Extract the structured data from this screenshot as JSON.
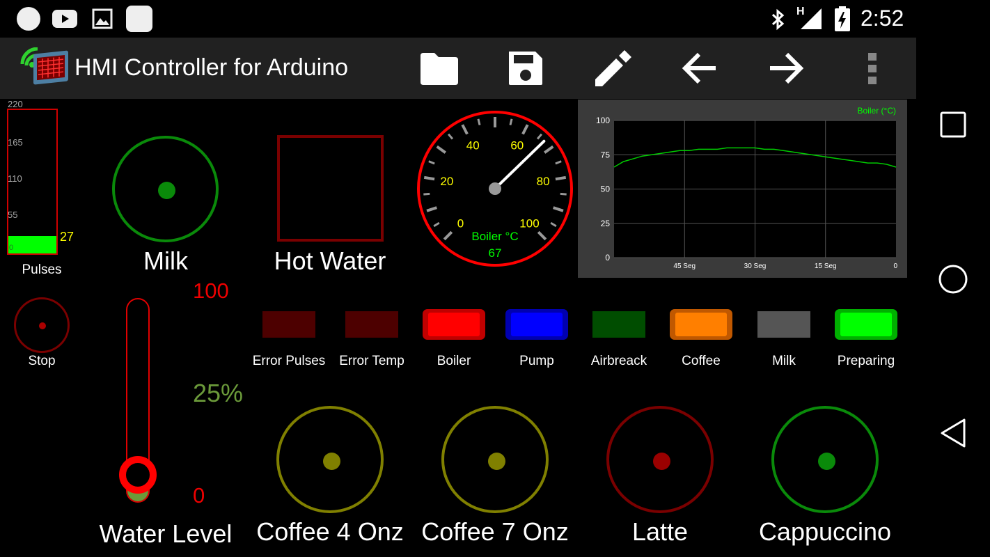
{
  "status_bar": {
    "time": "2:52",
    "network_type": "H"
  },
  "app_bar": {
    "title": "HMI Controller for Arduino",
    "actions": [
      "folder-icon",
      "save-icon",
      "edit-icon",
      "back-arrow-icon",
      "forward-arrow-icon",
      "more-vert-icon"
    ]
  },
  "pulses_bar": {
    "label": "Pulses",
    "ticks": [
      "220",
      "165",
      "110",
      "55",
      "0"
    ],
    "value": "27",
    "max": 220
  },
  "stop_button": {
    "label": "Stop"
  },
  "milk_button": {
    "label": "Milk"
  },
  "hot_water_button": {
    "label": "Hot Water"
  },
  "boiler_gauge": {
    "labels": [
      "0",
      "20",
      "40",
      "60",
      "80",
      "100"
    ],
    "unit_label": "Boiler °C",
    "value": "67"
  },
  "chart_data": {
    "type": "line",
    "legend": "Boiler (°C)",
    "legend_position": "top-right",
    "yticks": [
      "100",
      "75",
      "50",
      "25",
      "0"
    ],
    "xticks": [
      "45 Seg",
      "30 Seg",
      "15 Seg",
      "0"
    ],
    "ylim": [
      0,
      100
    ],
    "xlim": [
      60,
      0
    ],
    "grid": true,
    "series": [
      {
        "name": "Boiler (°C)",
        "x": [
          60,
          58,
          56,
          54,
          52,
          50,
          48,
          46,
          44,
          42,
          40,
          38,
          36,
          34,
          32,
          30,
          28,
          26,
          24,
          22,
          20,
          18,
          16,
          14,
          12,
          10,
          8,
          6,
          4,
          2,
          0
        ],
        "values": [
          66,
          70,
          72,
          74,
          75,
          76,
          77,
          78,
          78,
          79,
          79,
          79,
          80,
          80,
          80,
          80,
          79,
          79,
          78,
          77,
          76,
          75,
          74,
          73,
          72,
          71,
          70,
          69,
          69,
          68,
          66
        ]
      }
    ]
  },
  "water_level": {
    "label": "Water Level",
    "max": "100",
    "min": "0",
    "percent": "25%",
    "level": 0.25
  },
  "indicators": [
    {
      "label": "Error Pulses"
    },
    {
      "label": "Error Temp"
    },
    {
      "label": "Boiler"
    },
    {
      "label": "Pump"
    },
    {
      "label": "Airbreack"
    },
    {
      "label": "Coffee"
    },
    {
      "label": "Milk"
    },
    {
      "label": "Preparing"
    }
  ],
  "drink_buttons": [
    {
      "label": "Coffee 4 Onz"
    },
    {
      "label": "Coffee 7 Onz"
    },
    {
      "label": "Latte"
    },
    {
      "label": "Cappuccino"
    }
  ],
  "colors": {
    "green_ring": "#0a8a0a",
    "red_dark": "#7a0000",
    "olive": "#808000",
    "lamp_red_off": "#4d0000",
    "lamp_red_on": "#ff0000",
    "lamp_blue_on": "#0000ff",
    "lamp_green_off": "#004d00",
    "lamp_orange_on": "#ff7f00",
    "lamp_grey": "#555555",
    "lamp_green_on": "#00ff00",
    "gauge_yellow": "#ffff00"
  }
}
